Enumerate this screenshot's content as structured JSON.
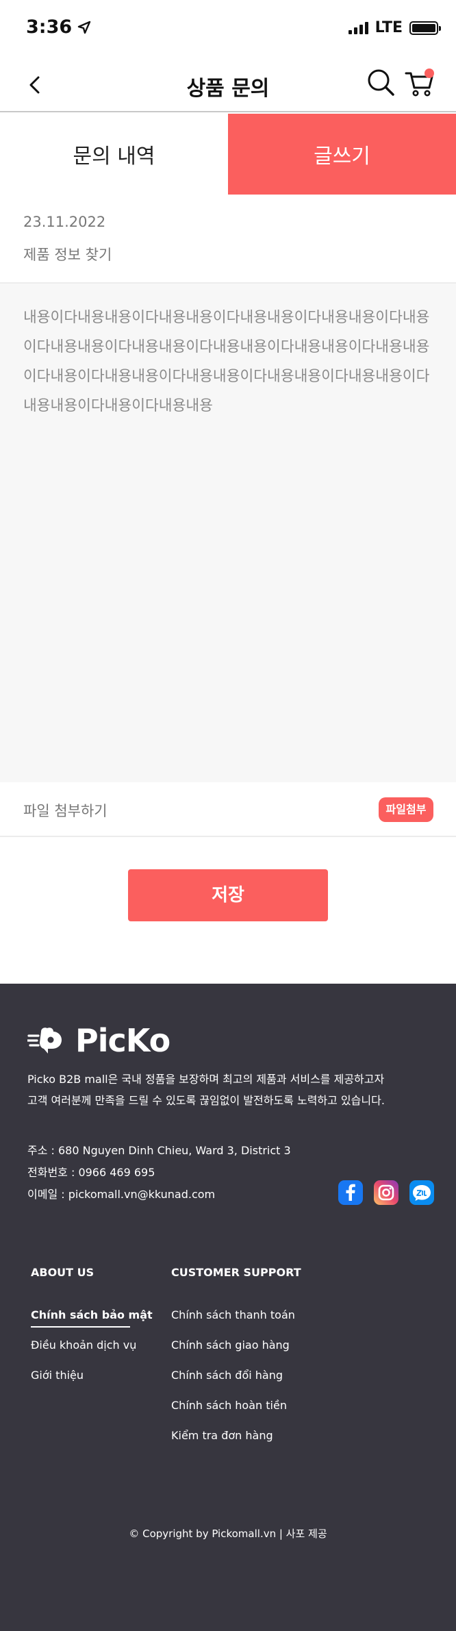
{
  "status_bar": {
    "time": "3:36",
    "network": "LTE"
  },
  "header": {
    "title": "상품 문의"
  },
  "tabs": [
    {
      "label": "문의 내역"
    },
    {
      "label": "글쓰기"
    }
  ],
  "inquiry": {
    "date": "23.11.2022",
    "product": "제품 정보 찾기",
    "content": "내용이다내용내용이다내용내용이다내용내용이다내용내용이다내용이다내용내용이다내용내용이다내용내용이다내용내용이다내용내용이다내용이다내용내용이다내용내용이다내용내용이다내용내용이다내용내용이다내용이다내용내용"
  },
  "attach": {
    "label": "파일 첨부하기",
    "button": "파일첨부"
  },
  "save_button": "저장",
  "footer": {
    "brand": "PicKo",
    "intro_line1": "Picko B2B mall은 국내 정품을 보장하며 최고의 제품과 서비스를 제공하고자",
    "intro_line2": "고객 여러분께 만족을 드릴 수 있도록 끊임없이 발전하도록 노력하고 있습니다.",
    "address": "주소 : 680 Nguyen Dinh Chieu, Ward 3, District 3",
    "phone": "전화번호 : 0966 469 695",
    "email": "이메일 : pickomall.vn@kkunad.com",
    "social": [
      "facebook-icon",
      "instagram-icon",
      "zalo-icon"
    ],
    "about_title": "ABOUT US",
    "about_links": [
      "Chính sách bảo mật",
      "Điều khoản dịch vụ",
      "Giới thiệu"
    ],
    "support_title": "CUSTOMER SUPPORT",
    "support_links": [
      "Chính sách thanh toán",
      "Chính sách giao hàng",
      "Chính sách đổi hàng",
      "Chính sách hoàn tiền",
      "Kiểm tra đơn hàng"
    ],
    "copyright": "© Copyright by Pickomall.vn | 사포 제공"
  },
  "colors": {
    "accent": "#fb5f5e",
    "footer_bg": "#37363f"
  }
}
